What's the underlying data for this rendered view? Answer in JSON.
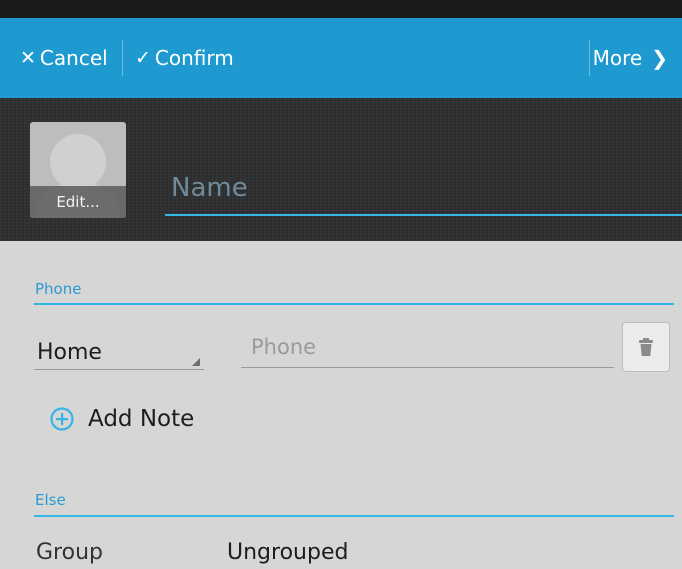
{
  "colors": {
    "actionbar": "#1e9ad0",
    "accent": "#33b5e5",
    "header_bg": "#2e2f31",
    "body_bg": "#d6d6d6"
  },
  "actionbar": {
    "cancel_icon": "close-icon",
    "cancel_label": "Cancel",
    "confirm_icon": "checkmark-icon",
    "confirm_label": "Confirm",
    "more_label": "More",
    "more_icon": "chevron-right-icon"
  },
  "header": {
    "avatar_icon": "person-silhouette-icon",
    "avatar_edit_label": "Edit...",
    "name_placeholder": "Name"
  },
  "phone_section": {
    "title": "Phone",
    "type_selected": "Home",
    "phone_placeholder": "Phone",
    "delete_icon": "trash-icon"
  },
  "add_note": {
    "icon": "plus-circle-icon",
    "label": "Add Note"
  },
  "else_section": {
    "title": "Else",
    "group_label": "Group",
    "group_value": "Ungrouped"
  }
}
